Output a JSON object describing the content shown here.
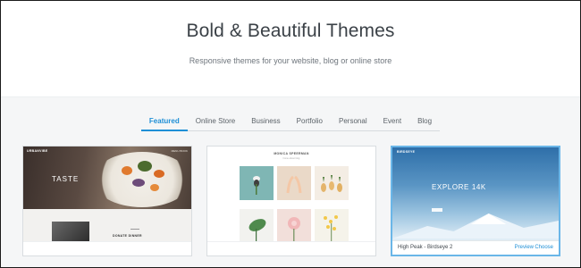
{
  "hero": {
    "title": "Bold & Beautiful Themes",
    "subtitle": "Responsive themes for your website, blog or online store"
  },
  "tabs": [
    {
      "label": "Featured",
      "active": true
    },
    {
      "label": "Online Store",
      "active": false
    },
    {
      "label": "Business",
      "active": false
    },
    {
      "label": "Portfolio",
      "active": false
    },
    {
      "label": "Personal",
      "active": false
    },
    {
      "label": "Event",
      "active": false
    },
    {
      "label": "Blog",
      "active": false
    }
  ],
  "cards": [
    {
      "brand": "URBANVIBE",
      "nav": "MENU  BOOK",
      "headline": "TASTE",
      "section_label": "DONATE DINNER"
    },
    {
      "brand": "MONICA SPEERMAN",
      "nav": "home  about  blog"
    },
    {
      "brand": "BIRDSEYE",
      "headline": "EXPLORE 14K",
      "name": "High Peak - Birdseye 2",
      "preview_label": "Preview",
      "choose_label": "Choose"
    }
  ],
  "colors": {
    "accent": "#1e8fd6",
    "selected_border": "#6ab6e8",
    "background": "#f5f6f7"
  }
}
